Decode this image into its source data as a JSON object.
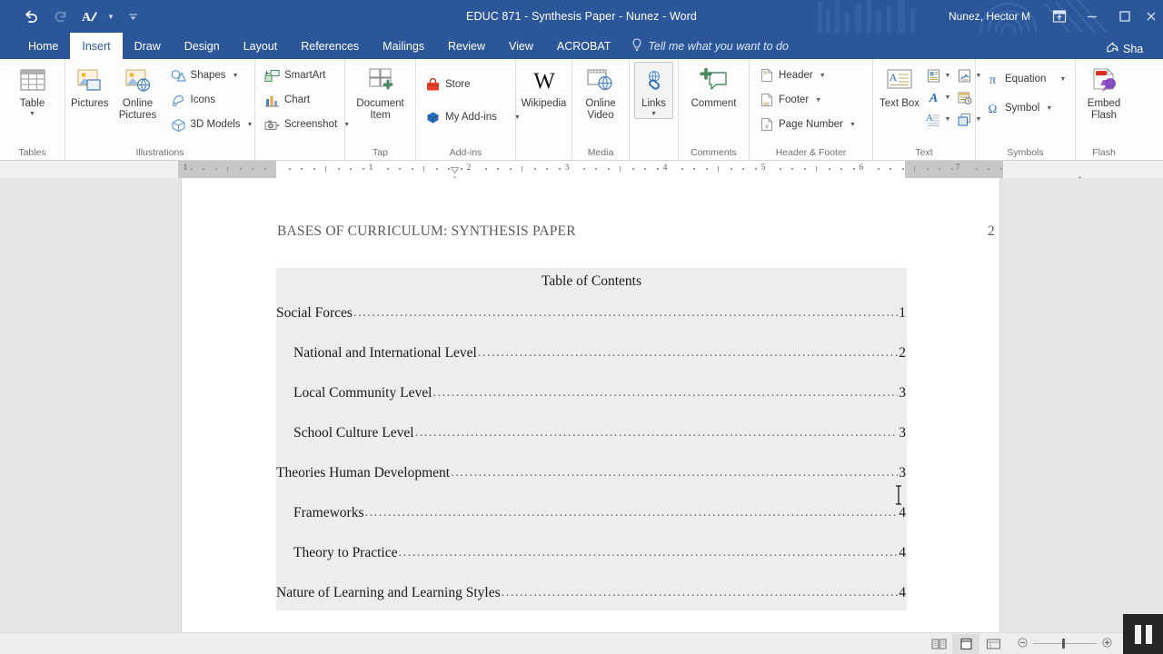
{
  "window": {
    "title": "EDUC 871 - Synthesis Paper - Nunez  -  Word",
    "user": "Nunez, Hector M",
    "quick_access": [
      {
        "name": "undo-icon",
        "label": "Undo"
      },
      {
        "name": "redo-icon",
        "label": "Redo"
      },
      {
        "name": "repeat-style-icon",
        "label": "Repeat Style"
      },
      {
        "name": "customize-qat-icon",
        "label": "Customize Quick Access Toolbar"
      }
    ],
    "controls": [
      {
        "name": "ribbon-display-options-icon",
        "label": "Ribbon Display Options"
      },
      {
        "name": "minimize-icon",
        "label": "Minimize"
      },
      {
        "name": "maximize-icon",
        "label": "Maximize"
      }
    ]
  },
  "tabs": [
    {
      "label": "Home",
      "active": false
    },
    {
      "label": "Insert",
      "active": true
    },
    {
      "label": "Draw",
      "active": false
    },
    {
      "label": "Design",
      "active": false
    },
    {
      "label": "Layout",
      "active": false
    },
    {
      "label": "References",
      "active": false
    },
    {
      "label": "Mailings",
      "active": false
    },
    {
      "label": "Review",
      "active": false
    },
    {
      "label": "View",
      "active": false
    },
    {
      "label": "ACROBAT",
      "active": false
    }
  ],
  "tell_me": {
    "placeholder": "Tell me what you want to do"
  },
  "share": {
    "label": "Sha"
  },
  "ribbon": {
    "groups": [
      {
        "label": "Tables",
        "big": [
          {
            "label": "Table",
            "icon": "table-icon",
            "caret": true
          }
        ],
        "small": [],
        "matrix": []
      },
      {
        "label": "Illustrations",
        "big": [
          {
            "label": "Pictures",
            "icon": "pictures-icon",
            "caret": false
          },
          {
            "label": "Online Pictures",
            "icon": "online-pictures-icon",
            "caret": false
          }
        ],
        "small": [
          {
            "label": "Shapes",
            "icon": "shapes-icon",
            "caret": true
          },
          {
            "label": "Icons",
            "icon": "icons-icon",
            "caret": false
          },
          {
            "label": "3D Models",
            "icon": "3d-models-icon",
            "caret": true
          }
        ],
        "matrix": []
      },
      {
        "label": "",
        "big": [],
        "small": [
          {
            "label": "SmartArt",
            "icon": "smartart-icon",
            "caret": false
          },
          {
            "label": "Chart",
            "icon": "chart-icon",
            "caret": false
          },
          {
            "label": "Screenshot",
            "icon": "screenshot-icon",
            "caret": true
          }
        ],
        "matrix": []
      },
      {
        "label": "Tap",
        "big": [
          {
            "label": "Document Item",
            "icon": "document-item-icon",
            "caret": false
          }
        ],
        "small": [],
        "matrix": []
      },
      {
        "label": "Add-ins",
        "big": [],
        "small": [
          {
            "label": "Store",
            "icon": "store-icon",
            "caret": false
          },
          {
            "label": "My Add-ins",
            "icon": "my-addins-icon",
            "caret": true
          }
        ],
        "matrix": []
      },
      {
        "label": "",
        "big": [
          {
            "label": "Wikipedia",
            "icon": "wikipedia-icon",
            "caret": false
          }
        ],
        "small": [],
        "matrix": []
      },
      {
        "label": "Media",
        "big": [
          {
            "label": "Online Video",
            "icon": "online-video-icon",
            "caret": false
          }
        ],
        "small": [],
        "matrix": []
      },
      {
        "label": "",
        "big": [
          {
            "label": "Links",
            "icon": "links-icon",
            "caret": true,
            "selected": true
          }
        ],
        "small": [],
        "matrix": []
      },
      {
        "label": "Comments",
        "big": [
          {
            "label": "Comment",
            "icon": "comment-icon",
            "caret": false
          }
        ],
        "small": [],
        "matrix": []
      },
      {
        "label": "Header & Footer",
        "big": [],
        "small": [
          {
            "label": "Header",
            "icon": "header-icon",
            "caret": true
          },
          {
            "label": "Footer",
            "icon": "footer-icon",
            "caret": true
          },
          {
            "label": "Page Number",
            "icon": "page-number-icon",
            "caret": true
          }
        ],
        "matrix": []
      },
      {
        "label": "Text",
        "big": [
          {
            "label": "Text Box",
            "icon": "text-box-icon",
            "caret": true
          }
        ],
        "small": [],
        "matrix": [
          {
            "icon": "quick-parts-icon",
            "caret": true
          },
          {
            "icon": "signature-line-icon",
            "caret": true
          },
          {
            "icon": "wordart-icon",
            "caret": true
          },
          {
            "icon": "date-time-icon",
            "caret": false
          },
          {
            "icon": "drop-cap-icon",
            "caret": true
          },
          {
            "icon": "object-icon",
            "caret": true
          }
        ]
      },
      {
        "label": "Symbols",
        "big": [],
        "small": [
          {
            "label": "Equation",
            "icon": "equation-icon",
            "caret": true
          },
          {
            "label": "Symbol",
            "icon": "symbol-icon",
            "caret": true
          }
        ],
        "matrix": []
      },
      {
        "label": "Flash",
        "big": [
          {
            "label": "Embed Flash",
            "icon": "embed-flash-icon",
            "caret": false
          }
        ],
        "small": [],
        "matrix": []
      }
    ]
  },
  "ruler": {
    "numbers": [
      "1",
      "1",
      "2",
      "3",
      "4",
      "5",
      "6",
      "7"
    ],
    "left_margin_number": "1"
  },
  "document": {
    "running_head": "BASES OF CURRICULUM: SYNTHESIS PAPER",
    "page_number": "2",
    "toc_title": "Table of Contents",
    "toc_entries": [
      {
        "text": "Social Forces",
        "page": "1",
        "level": 1
      },
      {
        "text": "National and International Level",
        "page": "2",
        "level": 2
      },
      {
        "text": "Local Community Level",
        "page": "3",
        "level": 2
      },
      {
        "text": "School Culture Level",
        "page": "3",
        "level": 2
      },
      {
        "text": "Theories Human Development",
        "page": "3",
        "level": 1
      },
      {
        "text": "Frameworks",
        "page": "4",
        "level": 2
      },
      {
        "text": "Theory to Practice",
        "page": "4",
        "level": 2
      },
      {
        "text": "Nature of Learning and Learning Styles",
        "page": "4",
        "level": 1
      }
    ],
    "leader": "............................................................................................................................................................................"
  },
  "status_bar": {
    "views": [
      {
        "name": "read-mode-icon",
        "active": false
      },
      {
        "name": "print-layout-icon",
        "active": true
      },
      {
        "name": "web-layout-icon",
        "active": false
      }
    ]
  },
  "overlay": {
    "pause_label": "Pause"
  },
  "colors": {
    "word_blue": "#2b579a",
    "ribbon_bg": "#fdfdfd",
    "canvas_gray": "#e6e6e6",
    "field_shading": "#ededed"
  }
}
